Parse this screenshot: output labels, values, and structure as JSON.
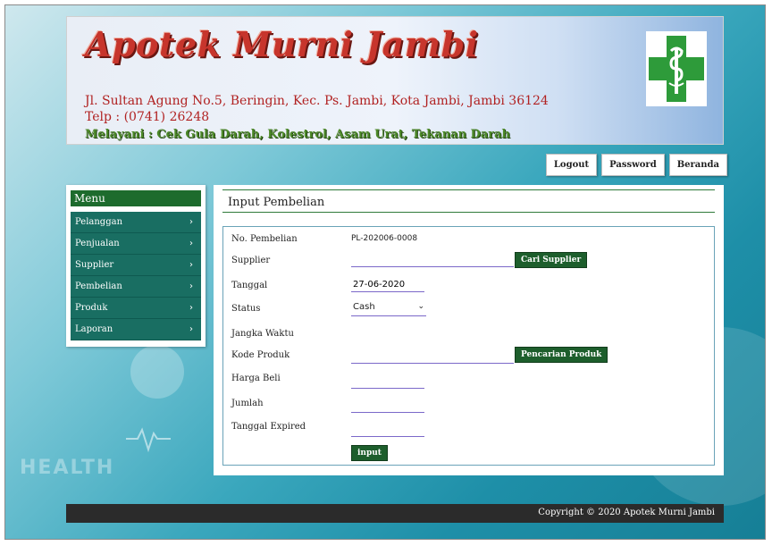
{
  "header": {
    "title": "Apotek Murni Jambi",
    "address": "Jl. Sultan Agung No.5, Beringin, Kec. Ps. Jambi, Kota Jambi, Jambi 36124",
    "phone": "Telp : (0741) 26248",
    "services": "Melayani : Cek Gula Darah, Kolestrol, Asam Urat, Tekanan Darah"
  },
  "topnav": {
    "logout": "Logout",
    "password": "Password",
    "beranda": "Beranda"
  },
  "sidebar": {
    "title": "Menu",
    "items": [
      {
        "label": "Pelanggan"
      },
      {
        "label": "Penjualan"
      },
      {
        "label": "Supplier"
      },
      {
        "label": "Pembelian"
      },
      {
        "label": "Produk"
      },
      {
        "label": "Laporan"
      }
    ]
  },
  "main": {
    "title": "Input Pembelian",
    "fields": {
      "no_pembelian_label": "No. Pembelian",
      "no_pembelian_value": "PL-202006-0008",
      "supplier_label": "Supplier",
      "supplier_value": "",
      "cari_supplier": "Cari Supplier",
      "tanggal_label": "Tanggal",
      "tanggal_value": "27-06-2020",
      "status_label": "Status",
      "status_value": "Cash",
      "jangka_label": "Jangka Waktu",
      "kode_label": "Kode Produk",
      "kode_value": "",
      "pencarian_produk": "Pencarian Produk",
      "harga_label": "Harga Beli",
      "harga_value": "",
      "jumlah_label": "Jumlah",
      "jumlah_value": "",
      "expired_label": "Tanggal Expired",
      "expired_value": "",
      "input_button": "input"
    }
  },
  "footer": {
    "copyright": "Copyright © 2020 Apotek Murni Jambi"
  },
  "background": {
    "watermark": "HEALTH"
  }
}
